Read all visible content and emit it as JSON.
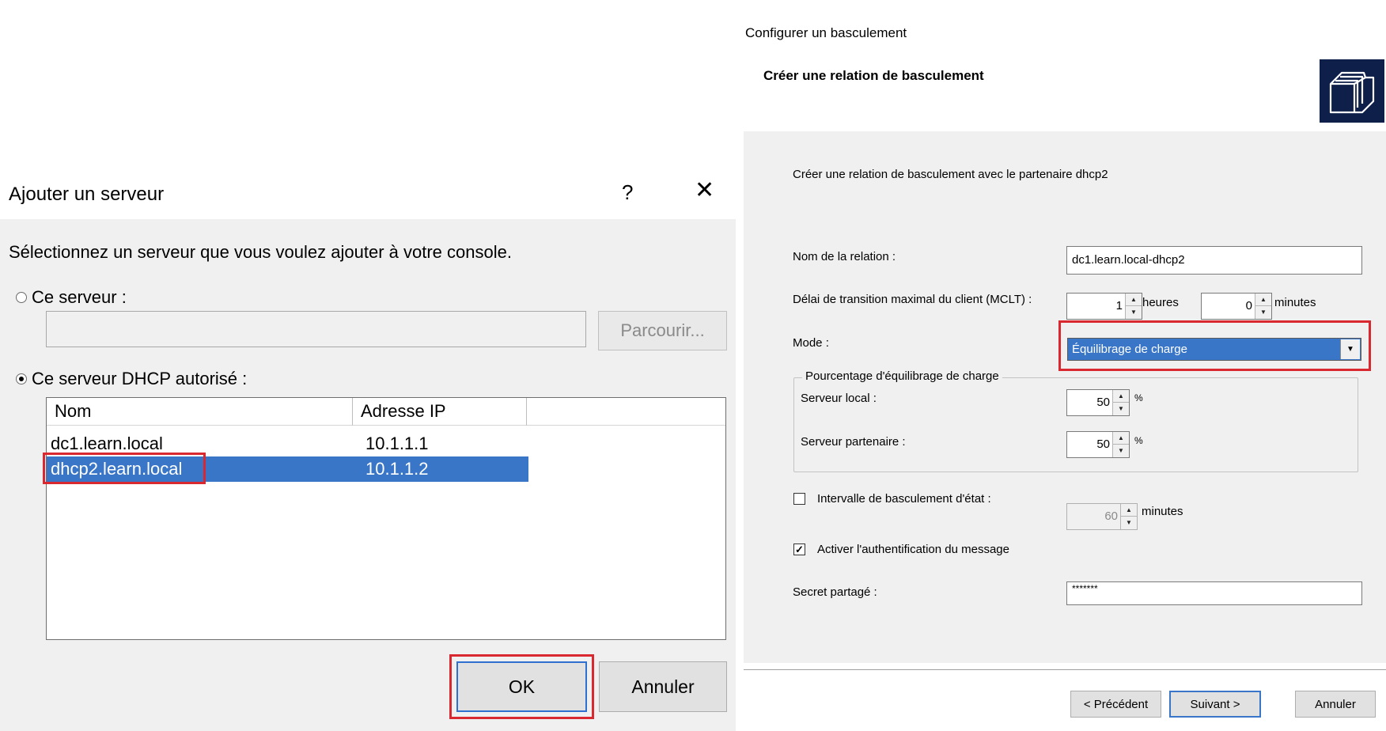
{
  "add_server": {
    "title": "Ajouter un serveur",
    "help_glyph": "?",
    "close_glyph": "✕",
    "instruction": "Sélectionnez un serveur que vous voulez ajouter à votre console.",
    "this_server_label": "Ce serveur :",
    "this_server_value": "",
    "browse_label": "Parcourir...",
    "authorized_label": "Ce serveur DHCP autorisé :",
    "columns": [
      "Nom",
      "Adresse IP",
      ""
    ],
    "rows": [
      {
        "name": "dc1.learn.local",
        "ip": "10.1.1.1"
      },
      {
        "name": "dhcp2.learn.local",
        "ip": "10.1.1.2"
      }
    ],
    "selected_row": 1,
    "ok_label": "OK",
    "cancel_label": "Annuler"
  },
  "failover": {
    "window_title": "Configurer un basculement",
    "header_title": "Créer une relation de basculement",
    "partner_text": "Créer une relation de basculement avec le partenaire dhcp2",
    "relation_label": "Nom de la relation :",
    "relation_value": "dc1.learn.local-dhcp2",
    "mclt_label": "Délai de transition maximal du client (MCLT) :",
    "mclt_hours": "1",
    "hours_label": "heures",
    "mclt_minutes": "0",
    "minutes_label": "minutes",
    "mode_label": "Mode :",
    "mode_value": "Équilibrage de charge",
    "lb_group_title": "Pourcentage d'équilibrage de charge",
    "local_label": "Serveur local :",
    "local_value": "50",
    "partner_label": "Serveur partenaire :",
    "partner_value": "50",
    "percent_sign": "%",
    "state_interval_label": "Intervalle de basculement d'état :",
    "state_interval_value": "60",
    "state_interval_checked": false,
    "auth_label": "Activer l'authentification du message",
    "auth_checked": true,
    "secret_label": "Secret partagé :",
    "secret_value": "*******",
    "prev_label": "< Précédent",
    "next_label": "Suivant >",
    "cancel_label": "Annuler"
  },
  "colors": {
    "highlight": "#d9282f",
    "selection": "#3a76c8"
  }
}
